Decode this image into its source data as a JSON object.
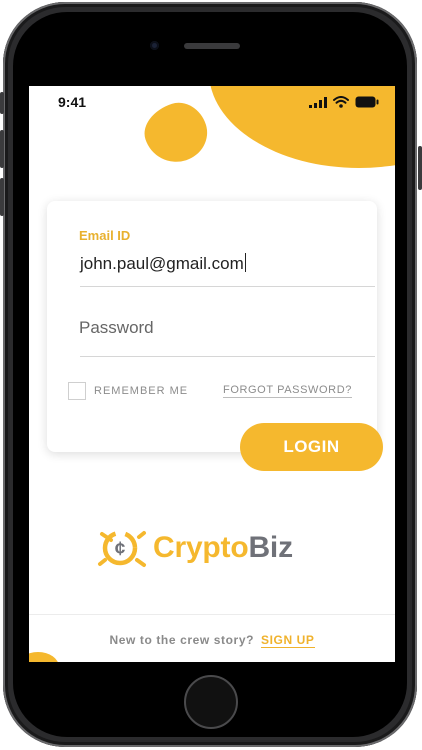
{
  "status_bar": {
    "time": "9:41"
  },
  "form": {
    "email_label": "Email ID",
    "email_value": "john.paul@gmail.com",
    "password_placeholder": "Password",
    "remember_label": "REMEMBER ME",
    "remember_checked": false,
    "forgot_label": "FORGOT PASSWORD?",
    "login_label": "LOGIN"
  },
  "brand": {
    "name_part1": "Crypto",
    "name_part2": "Biz",
    "logo_icon": "crypto-coin-icon"
  },
  "footer": {
    "question": "New to the crew story?",
    "signup_label": "SIGN UP"
  },
  "colors": {
    "accent": "#f5b82e",
    "brand_gray": "#6f7178",
    "text_gray": "#8c8c8c"
  }
}
